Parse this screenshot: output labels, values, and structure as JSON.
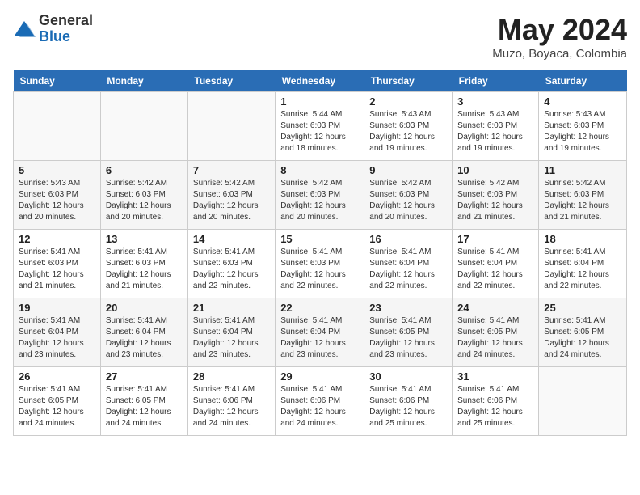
{
  "header": {
    "logo_general": "General",
    "logo_blue": "Blue",
    "month_year": "May 2024",
    "location": "Muzo, Boyaca, Colombia"
  },
  "weekdays": [
    "Sunday",
    "Monday",
    "Tuesday",
    "Wednesday",
    "Thursday",
    "Friday",
    "Saturday"
  ],
  "weeks": [
    [
      {
        "day": "",
        "sunrise": "",
        "sunset": "",
        "daylight": ""
      },
      {
        "day": "",
        "sunrise": "",
        "sunset": "",
        "daylight": ""
      },
      {
        "day": "",
        "sunrise": "",
        "sunset": "",
        "daylight": ""
      },
      {
        "day": "1",
        "sunrise": "5:44 AM",
        "sunset": "6:03 PM",
        "daylight": "12 hours and 18 minutes."
      },
      {
        "day": "2",
        "sunrise": "5:43 AM",
        "sunset": "6:03 PM",
        "daylight": "12 hours and 19 minutes."
      },
      {
        "day": "3",
        "sunrise": "5:43 AM",
        "sunset": "6:03 PM",
        "daylight": "12 hours and 19 minutes."
      },
      {
        "day": "4",
        "sunrise": "5:43 AM",
        "sunset": "6:03 PM",
        "daylight": "12 hours and 19 minutes."
      }
    ],
    [
      {
        "day": "5",
        "sunrise": "5:43 AM",
        "sunset": "6:03 PM",
        "daylight": "12 hours and 20 minutes."
      },
      {
        "day": "6",
        "sunrise": "5:42 AM",
        "sunset": "6:03 PM",
        "daylight": "12 hours and 20 minutes."
      },
      {
        "day": "7",
        "sunrise": "5:42 AM",
        "sunset": "6:03 PM",
        "daylight": "12 hours and 20 minutes."
      },
      {
        "day": "8",
        "sunrise": "5:42 AM",
        "sunset": "6:03 PM",
        "daylight": "12 hours and 20 minutes."
      },
      {
        "day": "9",
        "sunrise": "5:42 AM",
        "sunset": "6:03 PM",
        "daylight": "12 hours and 20 minutes."
      },
      {
        "day": "10",
        "sunrise": "5:42 AM",
        "sunset": "6:03 PM",
        "daylight": "12 hours and 21 minutes."
      },
      {
        "day": "11",
        "sunrise": "5:42 AM",
        "sunset": "6:03 PM",
        "daylight": "12 hours and 21 minutes."
      }
    ],
    [
      {
        "day": "12",
        "sunrise": "5:41 AM",
        "sunset": "6:03 PM",
        "daylight": "12 hours and 21 minutes."
      },
      {
        "day": "13",
        "sunrise": "5:41 AM",
        "sunset": "6:03 PM",
        "daylight": "12 hours and 21 minutes."
      },
      {
        "day": "14",
        "sunrise": "5:41 AM",
        "sunset": "6:03 PM",
        "daylight": "12 hours and 22 minutes."
      },
      {
        "day": "15",
        "sunrise": "5:41 AM",
        "sunset": "6:03 PM",
        "daylight": "12 hours and 22 minutes."
      },
      {
        "day": "16",
        "sunrise": "5:41 AM",
        "sunset": "6:04 PM",
        "daylight": "12 hours and 22 minutes."
      },
      {
        "day": "17",
        "sunrise": "5:41 AM",
        "sunset": "6:04 PM",
        "daylight": "12 hours and 22 minutes."
      },
      {
        "day": "18",
        "sunrise": "5:41 AM",
        "sunset": "6:04 PM",
        "daylight": "12 hours and 22 minutes."
      }
    ],
    [
      {
        "day": "19",
        "sunrise": "5:41 AM",
        "sunset": "6:04 PM",
        "daylight": "12 hours and 23 minutes."
      },
      {
        "day": "20",
        "sunrise": "5:41 AM",
        "sunset": "6:04 PM",
        "daylight": "12 hours and 23 minutes."
      },
      {
        "day": "21",
        "sunrise": "5:41 AM",
        "sunset": "6:04 PM",
        "daylight": "12 hours and 23 minutes."
      },
      {
        "day": "22",
        "sunrise": "5:41 AM",
        "sunset": "6:04 PM",
        "daylight": "12 hours and 23 minutes."
      },
      {
        "day": "23",
        "sunrise": "5:41 AM",
        "sunset": "6:05 PM",
        "daylight": "12 hours and 23 minutes."
      },
      {
        "day": "24",
        "sunrise": "5:41 AM",
        "sunset": "6:05 PM",
        "daylight": "12 hours and 24 minutes."
      },
      {
        "day": "25",
        "sunrise": "5:41 AM",
        "sunset": "6:05 PM",
        "daylight": "12 hours and 24 minutes."
      }
    ],
    [
      {
        "day": "26",
        "sunrise": "5:41 AM",
        "sunset": "6:05 PM",
        "daylight": "12 hours and 24 minutes."
      },
      {
        "day": "27",
        "sunrise": "5:41 AM",
        "sunset": "6:05 PM",
        "daylight": "12 hours and 24 minutes."
      },
      {
        "day": "28",
        "sunrise": "5:41 AM",
        "sunset": "6:06 PM",
        "daylight": "12 hours and 24 minutes."
      },
      {
        "day": "29",
        "sunrise": "5:41 AM",
        "sunset": "6:06 PM",
        "daylight": "12 hours and 24 minutes."
      },
      {
        "day": "30",
        "sunrise": "5:41 AM",
        "sunset": "6:06 PM",
        "daylight": "12 hours and 25 minutes."
      },
      {
        "day": "31",
        "sunrise": "5:41 AM",
        "sunset": "6:06 PM",
        "daylight": "12 hours and 25 minutes."
      },
      {
        "day": "",
        "sunrise": "",
        "sunset": "",
        "daylight": ""
      }
    ]
  ]
}
